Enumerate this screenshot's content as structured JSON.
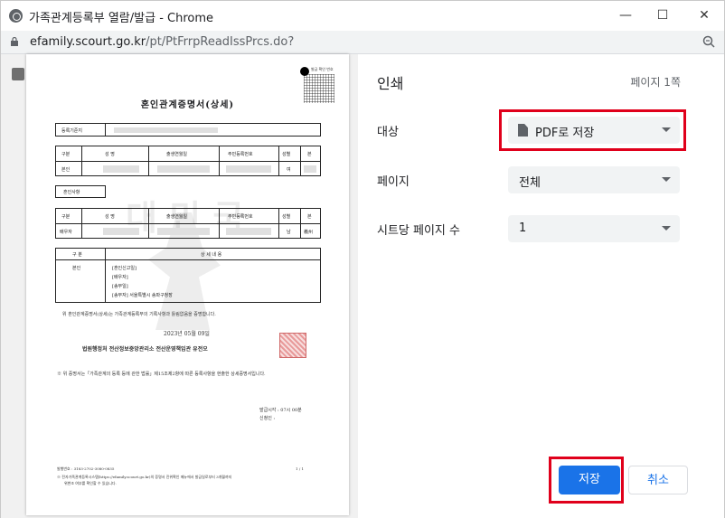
{
  "window": {
    "title": "가족관계등록부 열람/발급 - Chrome",
    "minimize": "—",
    "maximize": "☐",
    "close": "✕"
  },
  "address": {
    "domain": "efamily.scourt.go.kr",
    "path": "/pt/PtFrrpReadIssPrcs.do?"
  },
  "document": {
    "title": "혼인관계증명서(상세)",
    "qr_caption": "발급 확인 번호",
    "reg_label": "등록기준지",
    "header_cols": [
      "구분",
      "성 명",
      "출생연월일",
      "주민등록번호",
      "성별",
      "본"
    ],
    "row_self": {
      "kind": "본인",
      "gender": "여"
    },
    "marriage_section": "혼인사항",
    "row_spouse": {
      "kind": "배우자",
      "gender": "남",
      "origin": "義州"
    },
    "detail_header": [
      "구 분",
      "상 세 내 용"
    ],
    "detail_kind": "본인",
    "detail_items": [
      "[혼인신고일]",
      "[배우자]",
      "[송부일]",
      "[송부자]   서울특별시 송파구청장"
    ],
    "certify_text": "위 혼인관계증명서(상세)는 가족관계등록부의 기록사항과 틀림없음을 증명합니다.",
    "date": "2023년 05월 09일",
    "issuer": "법원행정처 전산정보중앙관리소 전산운영책임관 유전오",
    "note": "※ 위 증명서는「가족관계의 등록 등에 관한 법률」제15조제2항에 따른 등록사항을 현출한 상세증명서입니다.",
    "issue_time": "발급시각 : 07시 00분",
    "requester": "신청인 :",
    "footer_id": "발행번호 : 3183-2702-3080-0835",
    "footer_page": "1  /  1",
    "footer_note": "※ 전자가족관계등록시스템(https://efamily.scourt.go.kr)의 증명서 진위확인 메뉴에서 발급일로부터 3개월까지",
    "footer_note2": "위변조 여부를 확인할 수 있습니다.",
    "watermark": "대 민 국"
  },
  "panel": {
    "title": "인쇄",
    "page_count": "페이지 1쪽",
    "destination": {
      "label": "대상",
      "value": "PDF로 저장"
    },
    "pages": {
      "label": "페이지",
      "value": "전체"
    },
    "pages_per_sheet": {
      "label": "시트당 페이지 수",
      "value": "1"
    },
    "save_label": "저장",
    "cancel_label": "취소"
  },
  "colors": {
    "accent": "#1a73e8",
    "highlight": "#e0001b"
  }
}
